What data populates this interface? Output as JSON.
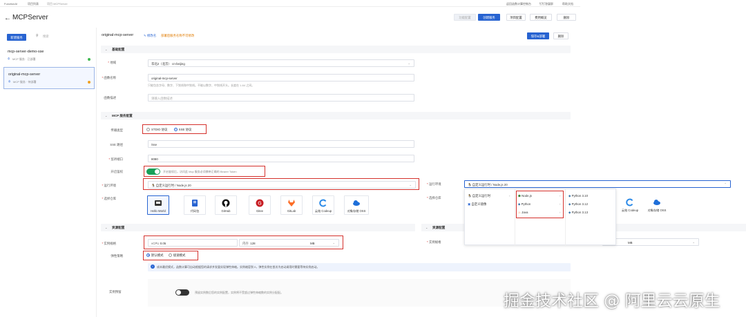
{
  "topbar": {
    "links": [
      "FunctionAI",
      "项目列表",
      "项目 MCPServer"
    ],
    "right_links": [
      "返回函数计算控制台",
      "钉钉答疑群",
      "帮助文档"
    ]
  },
  "header": {
    "title": "MCPServer",
    "buttons": [
      "功能配置",
      "创建服务",
      "项目配置",
      "费用概览",
      "删除"
    ]
  },
  "sidebar": {
    "new_button": "新建服务",
    "search_placeholder": "搜索",
    "items": [
      {
        "name": "mcp-server-demo-sse",
        "meta": "MCP 服务 · 已部署",
        "status_color": "#3fb950"
      },
      {
        "name": "original-mcp-server",
        "meta": "MCP 服务 · 待部署",
        "status_color": "#f0a020"
      }
    ]
  },
  "main": {
    "server_name": "original-mcp-server",
    "edit_link": "修改名",
    "warn_text": "部署后服务名称不可修改",
    "btn_save": "保存&部署",
    "btn_delete": "删除"
  },
  "basic": {
    "section": "基础配置",
    "region_label": "地域",
    "region_value": "华北2（北京）  cn-beijing",
    "fn_label": "函数名称",
    "fn_value": "original-mcp-server",
    "fn_hint": "只能包含字母、数字、下划线和中划线。不能以数字、中划线开头。长度在 1-64 之间。",
    "desc_label": "函数描述",
    "desc_placeholder": "请输入函数描述"
  },
  "mcp": {
    "section": "MCP 服务配置",
    "transport_label": "传输类型",
    "opt_stdio": "STDIO 协议",
    "opt_sse": "SSE 协议",
    "path_label": "SSE 路径",
    "path_value": "/sse",
    "port_label": "监听端口",
    "port_value": "8080",
    "auth_label": "开启鉴权",
    "auth_text": "开启鉴权后，访问此 Mcp 服务必须携带正确的 Bearer Token",
    "runtime_label": "运行环境",
    "runtime_value": "自定义运行时 / Node.js 20",
    "repo_label": "选择仓库",
    "repos": [
      "Hello World",
      "代码包",
      "GitHub",
      "Gitee",
      "GitLab",
      "云效 Codeup",
      "对象存储 OSS"
    ]
  },
  "resource": {
    "section": "资源配置",
    "spec_label": "实例规格",
    "vcpu_label": "vCPU",
    "vcpu_value": "0.05",
    "mem_label": "内存",
    "mem_value": "128",
    "mem_unit": "MB",
    "policy_label": "弹性策略",
    "opt_default": "默认模式",
    "opt_fast": "极速模式",
    "info_text": "成本最优模式，函数计算可自动根据您的请求并发量实现弹性伸缩。实例缩容到 0，弹性实例在首次冷启动调用时需要等待实例启动。",
    "prealloc_label": "实例预留",
    "prealloc_text": "预留实例数后您的实例配置，实例将不受超过弹性伸缩数的实例分配配。"
  },
  "overlay": {
    "runtime_label": "运行环境",
    "runtime_value": "自定义运行时 / Node.js 20",
    "repo_label": "选择仓库",
    "col1": [
      "自定义运行时",
      "自定义镜像"
    ],
    "col2": [
      "Node.js",
      "Python",
      "Java"
    ],
    "col3": [
      "Python 3.10",
      "Python 3.12",
      "Python 3.13"
    ],
    "partial_repos": [
      "云效 Codeup",
      "对象存储 OSS"
    ],
    "resource_section": "资源配置",
    "spec_label": "实例规格",
    "mem_unit": "MB"
  },
  "watermark": "掘金技术社区 @ 阿里云云原生",
  "colors": {
    "primary": "#2763d1",
    "highlight": "#d4302b",
    "toggle": "#18a058"
  }
}
